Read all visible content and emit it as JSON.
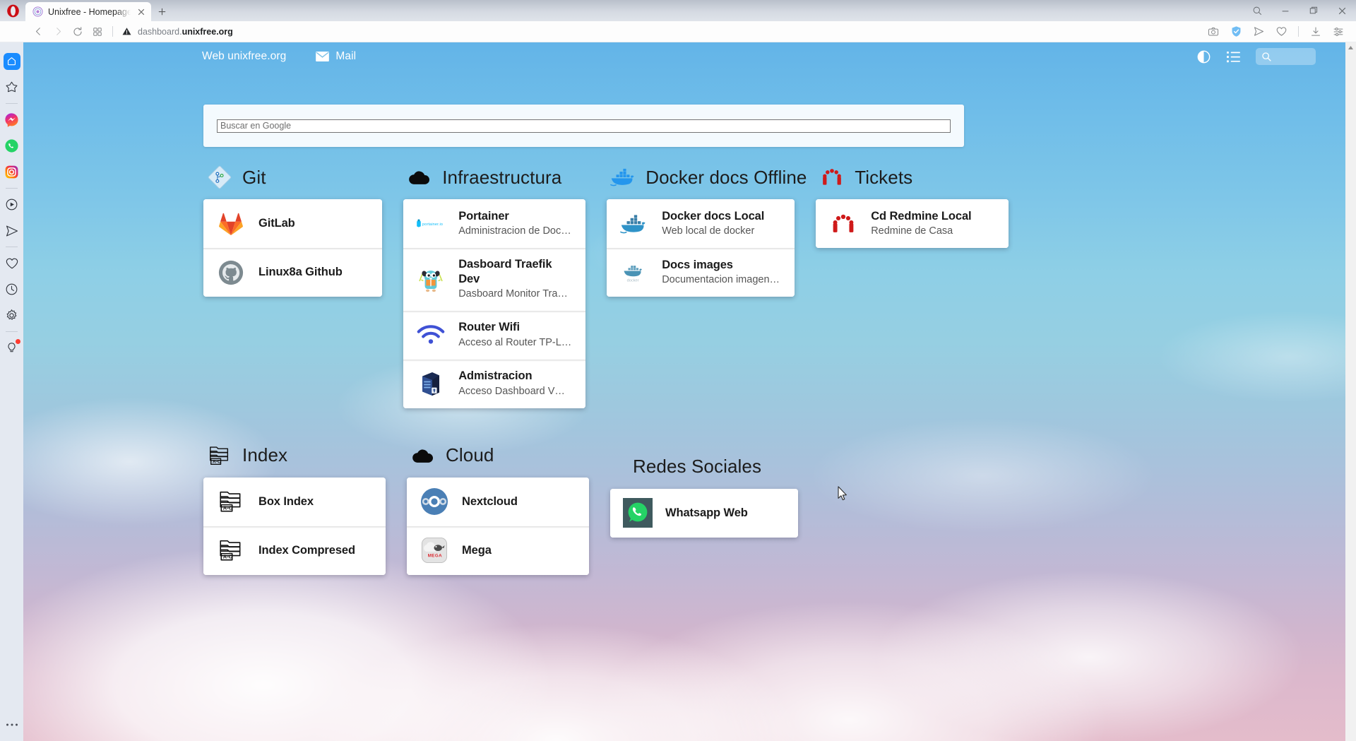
{
  "browser": {
    "name": "opera",
    "tab": {
      "title": "Unixfree - Homepage",
      "favicon": "unixfree-favicon"
    },
    "newtab_label": "+",
    "address": {
      "url_prefix": "dashboard.",
      "url_domain": "unixfree.org",
      "security": "not-secure-warning"
    },
    "nav_buttons": [
      "back-button",
      "forward-button",
      "reload-button",
      "tab-gallery-button"
    ],
    "toolbar_right": [
      "snapshot-icon",
      "vpn-shield-icon",
      "flow-send-icon",
      "heart-icon",
      "downloads-icon",
      "easy-setup-icon"
    ],
    "window_controls": [
      "search-icon",
      "minimize-icon",
      "maximize-icon",
      "close-icon"
    ],
    "sidebar": {
      "items": [
        {
          "name": "home",
          "icon": "house-icon",
          "active": true
        },
        {
          "name": "speed-dial",
          "icon": "star-icon",
          "active": false
        },
        {
          "name": "separator-1",
          "icon": "separator",
          "active": false
        },
        {
          "name": "messenger",
          "icon": "messenger-icon",
          "active": false
        },
        {
          "name": "whatsapp",
          "icon": "whatsapp-icon",
          "active": false
        },
        {
          "name": "instagram",
          "icon": "instagram-icon",
          "active": false
        },
        {
          "name": "separator-2",
          "icon": "separator",
          "active": false
        },
        {
          "name": "player",
          "icon": "play-circle-icon",
          "active": false
        },
        {
          "name": "flow",
          "icon": "paper-plane-icon",
          "active": false
        },
        {
          "name": "separator-3",
          "icon": "separator",
          "active": false
        },
        {
          "name": "bookmarks",
          "icon": "heart-icon",
          "active": false
        },
        {
          "name": "history",
          "icon": "clock-icon",
          "active": false
        },
        {
          "name": "settings",
          "icon": "gear-icon",
          "active": false
        },
        {
          "name": "separator-4",
          "icon": "separator",
          "active": false
        },
        {
          "name": "easy-setup",
          "icon": "lightbulb-icon",
          "active": false,
          "badge": true
        }
      ],
      "overflow": "more-dots-icon"
    }
  },
  "dashboard": {
    "header": {
      "links": [
        {
          "label": "Web unixfree.org",
          "icon": null
        },
        {
          "label": "Mail",
          "icon": "envelope-icon"
        }
      ],
      "actions": [
        {
          "name": "dark-mode-toggle",
          "icon": "contrast-icon"
        },
        {
          "name": "layout-toggle",
          "icon": "list-icon"
        }
      ],
      "search": {
        "icon": "search-icon",
        "value": ""
      }
    },
    "search_card": {
      "placeholder": "Buscar en Google",
      "value": ""
    },
    "groups": [
      {
        "title": "Git",
        "icon": "git-diamond-icon",
        "items": [
          {
            "title": "GitLab",
            "subtitle": "",
            "icon": "gitlab-icon"
          },
          {
            "title": "Linux8a Github",
            "subtitle": "",
            "icon": "github-icon"
          }
        ]
      },
      {
        "title": "Infraestructura",
        "icon": "cloud-icon",
        "items": [
          {
            "title": "Portainer",
            "subtitle": "Administracion de Docker via …",
            "icon": "portainer-icon"
          },
          {
            "title": "Dasboard Traefik Dev",
            "subtitle": "Dasboard Monitor Traefik Dev…",
            "icon": "traefik-gopher-icon"
          },
          {
            "title": "Router Wifi",
            "subtitle": "Acceso al Router TP-Link",
            "icon": "wifi-icon"
          },
          {
            "title": "Admistracion",
            "subtitle": "Acceso Dashboard VM Deskt…",
            "icon": "server-icon"
          }
        ]
      },
      {
        "title": "Docker docs Offline",
        "icon": "docker-whale-icon",
        "items": [
          {
            "title": "Docker docs Local",
            "subtitle": "Web local de docker",
            "icon": "docker-whale-icon"
          },
          {
            "title": "Docs images",
            "subtitle": "Documentacion imagenes ofi…",
            "icon": "docker-small-icon"
          }
        ]
      },
      {
        "title": "Tickets",
        "icon": "redmine-icon",
        "items": [
          {
            "title": "Cd Redmine Local",
            "subtitle": "Redmine de Casa",
            "icon": "redmine-icon"
          }
        ]
      },
      {
        "title": "Index",
        "icon": "file-index-icon",
        "items": [
          {
            "title": "Box Index",
            "subtitle": "",
            "icon": "file-index-icon"
          },
          {
            "title": "Index Compresed",
            "subtitle": "",
            "icon": "file-index-icon"
          }
        ]
      },
      {
        "title": "Cloud",
        "icon": "cloud-icon",
        "items": [
          {
            "title": "Nextcloud",
            "subtitle": "",
            "icon": "nextcloud-icon"
          },
          {
            "title": "Mega",
            "subtitle": "",
            "icon": "mega-icon"
          }
        ]
      },
      {
        "title": "Redes Sociales",
        "icon": null,
        "items": [
          {
            "title": "Whatsapp Web",
            "subtitle": "",
            "icon": "whatsapp-square-icon"
          }
        ]
      }
    ]
  },
  "colors": {
    "accent": "#1a8cff",
    "gitlab_orange": "#fc6d26",
    "docker_blue": "#2496ed",
    "redmine_red": "#c61a1a",
    "nextcloud_blue": "#4a7fb5",
    "whatsapp_green": "#25d366",
    "sky_top": "#63b4e8",
    "sky_bottom": "#e4bccb"
  }
}
